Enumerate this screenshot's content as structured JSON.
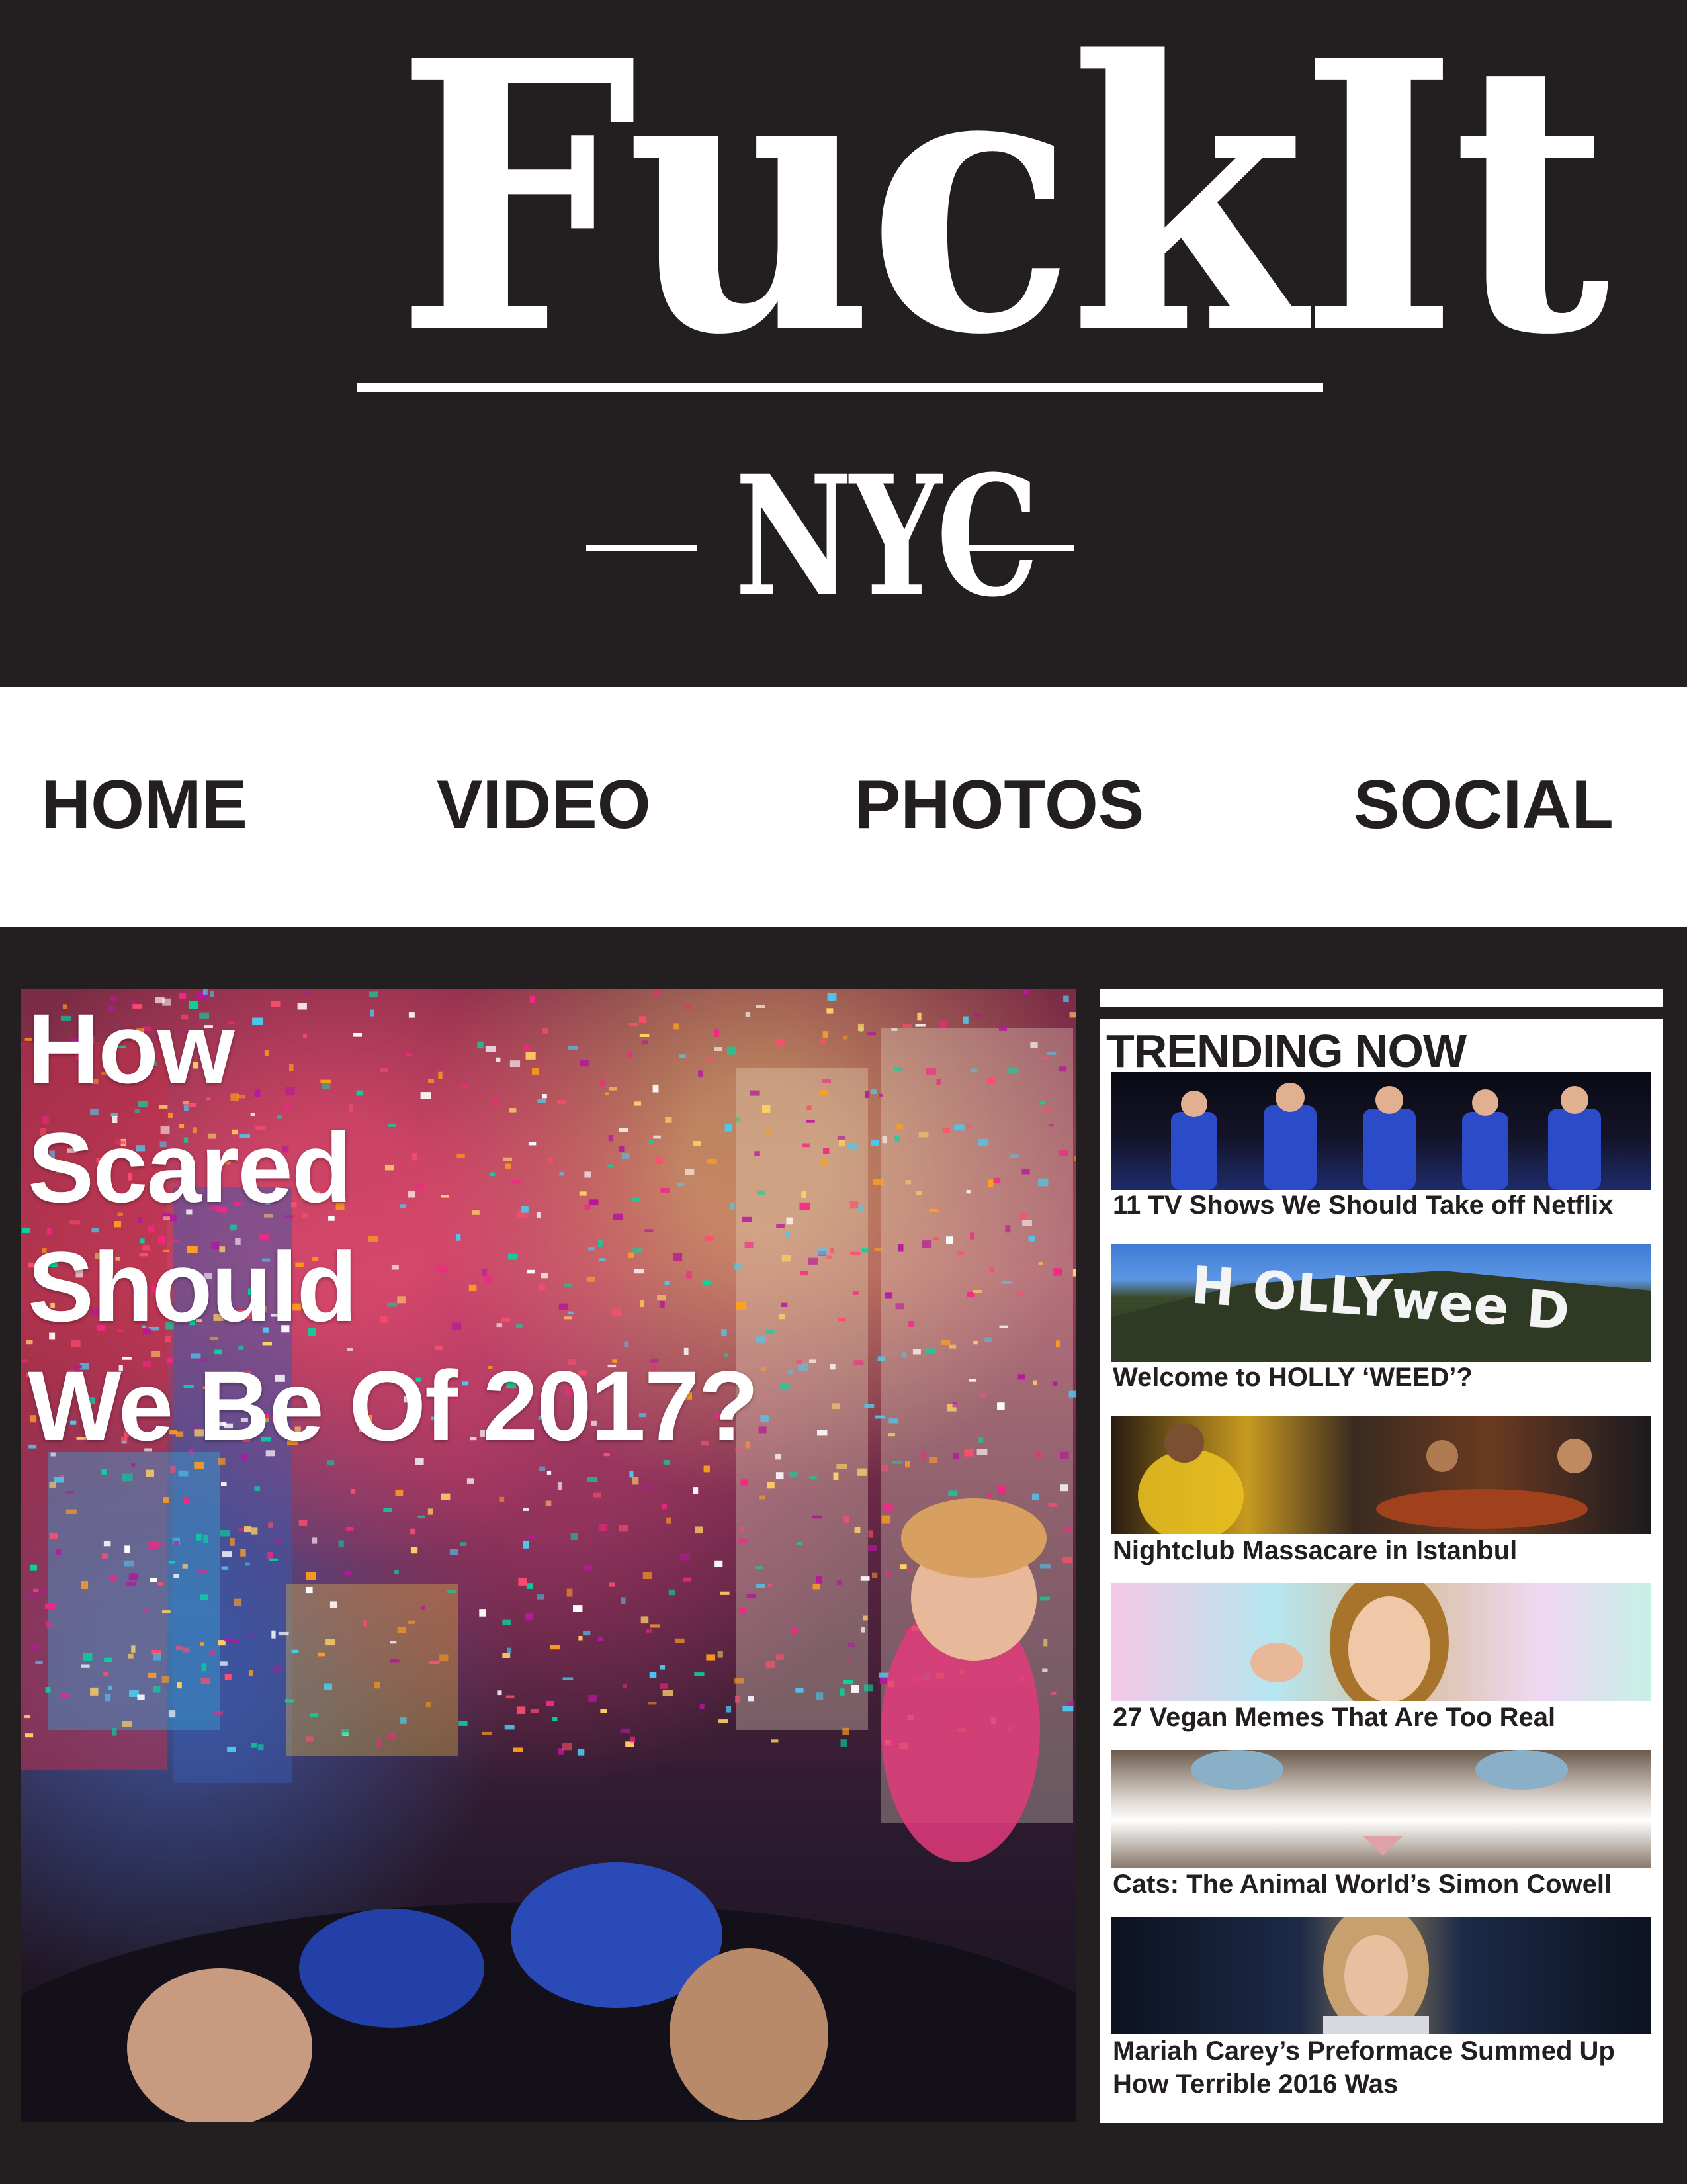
{
  "masthead": {
    "logo_main": "FuckIt",
    "logo_sub": "NYC"
  },
  "nav": {
    "items": [
      {
        "label": "HOME"
      },
      {
        "label": "VIDEO"
      },
      {
        "label": "PHOTOS"
      },
      {
        "label": "SOCIAL"
      }
    ]
  },
  "hero": {
    "title_lines": [
      "How",
      "Scared",
      "Should",
      "We Be Of 2017?"
    ]
  },
  "trending": {
    "heading": "TRENDING NOW",
    "items": [
      {
        "caption_lines": [
          "11 TV Shows We Should Take off Netflix"
        ]
      },
      {
        "caption_lines": [
          "Welcome to HOLLY ‘WEED’?"
        ],
        "thumb_text": "H OLLYwee D"
      },
      {
        "caption_lines": [
          "Nightclub Massacare in Istanbul"
        ]
      },
      {
        "caption_lines": [
          "27 Vegan Memes That Are Too Real"
        ]
      },
      {
        "caption_lines": [
          "Cats: The Animal World’s Simon Cowell"
        ]
      },
      {
        "caption_lines": [
          "Mariah Carey’s Preformace Summed Up",
          "How Terrible 2016 Was"
        ]
      }
    ]
  },
  "colors": {
    "background": "#231f20",
    "nav_background": "#ffffff",
    "text_light": "#ffffff",
    "text_dark": "#231f20"
  }
}
